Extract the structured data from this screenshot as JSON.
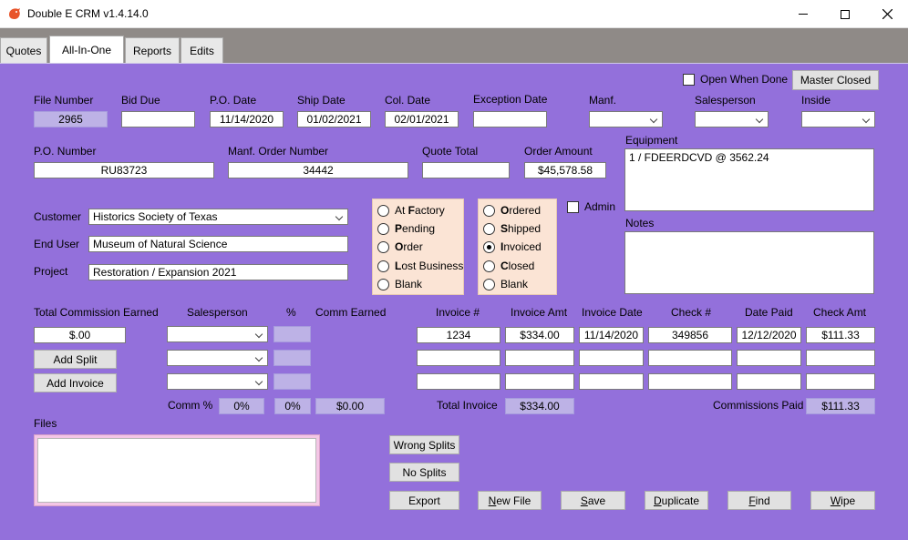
{
  "window": {
    "title": "Double E CRM v1.4.14.0"
  },
  "tabs": [
    "Quotes",
    "All-In-One",
    "Reports",
    "Edits"
  ],
  "top": {
    "open_when_done_label": "Open When Done",
    "master_closed_label": "Master Closed"
  },
  "row1": {
    "file_number_label": "File Number",
    "file_number": "2965",
    "bid_due_label": "Bid Due",
    "bid_due": "",
    "po_date_label": "P.O. Date",
    "po_date": "11/14/2020",
    "ship_date_label": "Ship Date",
    "ship_date": "01/02/2021",
    "col_date_label": "Col. Date",
    "col_date": "02/01/2021",
    "exception_date_label": "Exception Date",
    "exception_date": "",
    "manf_label": "Manf.",
    "salesperson_label": "Salesperson",
    "inside_label": "Inside"
  },
  "row2": {
    "po_number_label": "P.O. Number",
    "po_number": "RU83723",
    "manf_order_label": "Manf. Order Number",
    "manf_order": "34442",
    "quote_total_label": "Quote Total",
    "quote_total": "",
    "order_amount_label": "Order Amount",
    "order_amount": "$45,578.58"
  },
  "equipment": {
    "label": "Equipment",
    "text": "1 / FDEERDCVD @ 3562.24"
  },
  "notes": {
    "label": "Notes",
    "text": ""
  },
  "customer": {
    "customer_label": "Customer",
    "customer": "Historics Society of Texas",
    "end_user_label": "End User",
    "end_user": "Museum of Natural Science",
    "project_label": "Project",
    "project": "Restoration / Expansion 2021"
  },
  "status1": [
    {
      "key": "F",
      "pre": "At ",
      "post": "actory",
      "checked": false
    },
    {
      "key": "P",
      "pre": "",
      "post": "ending",
      "checked": false
    },
    {
      "key": "O",
      "pre": "",
      "post": "rder",
      "checked": false
    },
    {
      "key": "L",
      "pre": "",
      "post": "ost Business",
      "checked": false
    },
    {
      "key": "",
      "pre": "Blank",
      "post": "",
      "checked": false
    }
  ],
  "status2": [
    {
      "key": "O",
      "pre": "",
      "post": "rdered",
      "checked": false
    },
    {
      "key": "S",
      "pre": "",
      "post": "hipped",
      "checked": false
    },
    {
      "key": "I",
      "pre": "",
      "post": "nvoiced",
      "checked": true
    },
    {
      "key": "C",
      "pre": "",
      "post": "losed",
      "checked": false
    },
    {
      "key": "",
      "pre": "Blank",
      "post": "",
      "checked": false
    }
  ],
  "admin_label": "Admin",
  "commission": {
    "total_label": "Total Commission Earned",
    "total": "$.00",
    "salesperson_label": "Salesperson",
    "pct_label": "%",
    "earned_label": "Comm Earned",
    "add_split_label": "Add Split",
    "add_invoice_label": "Add Invoice",
    "comm_pct_label": "Comm %",
    "comm_pct_1": "0%",
    "comm_pct_2": "0%",
    "comm_total": "$0.00"
  },
  "invoice": {
    "headers": [
      "Invoice #",
      "Invoice Amt",
      "Invoice Date",
      "Check #",
      "Date Paid",
      "Check Amt"
    ],
    "rows": [
      [
        "1234",
        "$334.00",
        "11/14/2020",
        "349856",
        "12/12/2020",
        "$111.33"
      ],
      [
        "",
        "",
        "",
        "",
        "",
        ""
      ],
      [
        "",
        "",
        "",
        "",
        "",
        ""
      ]
    ],
    "total_label": "Total Invoice",
    "total": "$334.00",
    "commissions_paid_label": "Commissions Paid",
    "commissions_paid": "$111.33"
  },
  "files_label": "Files",
  "buttons": {
    "wrong_splits": "Wrong Splits",
    "no_splits": "No Splits",
    "export": "Export",
    "new_file": {
      "key": "N",
      "rest": "ew File"
    },
    "save": {
      "key": "S",
      "rest": "ave"
    },
    "duplicate": {
      "key": "D",
      "rest": "uplicate"
    },
    "find": {
      "key": "F",
      "rest": "ind"
    },
    "wipe": {
      "key": "W",
      "rest": "ipe"
    }
  }
}
